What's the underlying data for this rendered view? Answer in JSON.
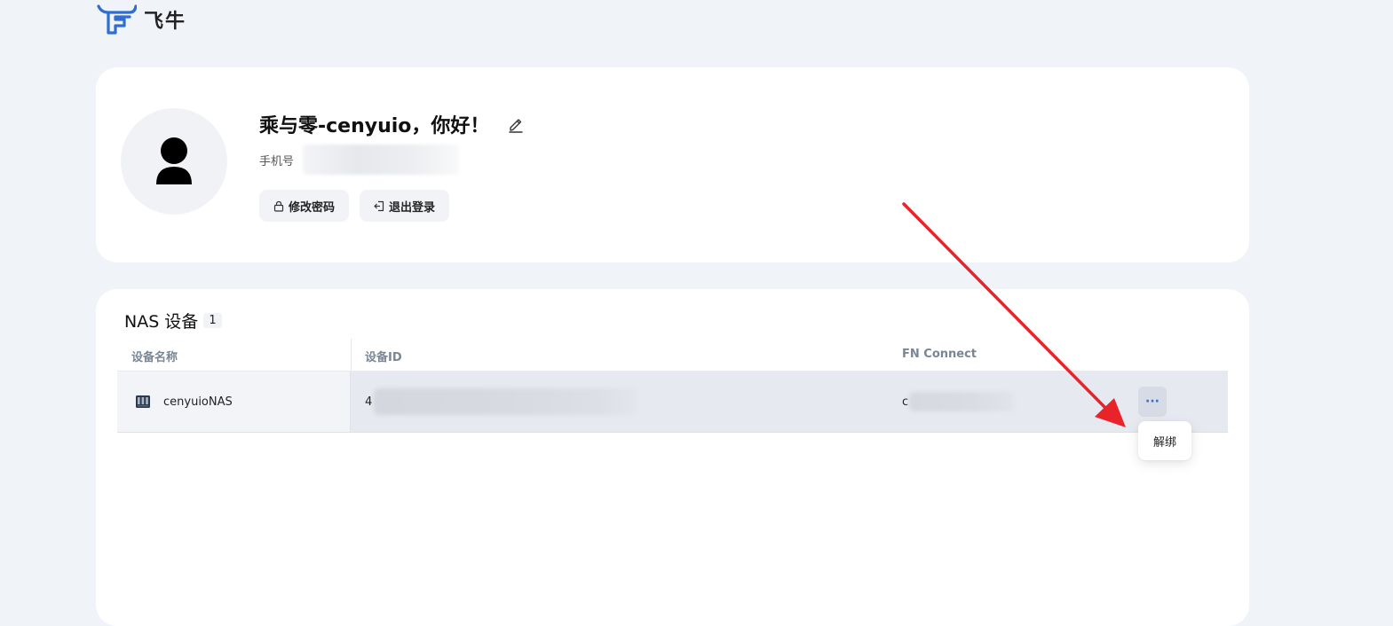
{
  "logo": {
    "text": "飞牛",
    "color": "#2f6ed1"
  },
  "profile": {
    "greeting": "乘与零-cenyuio，你好！",
    "phone_label": "手机号",
    "buttons": {
      "change_password": "修改密码",
      "logout": "退出登录"
    }
  },
  "devices": {
    "title": "NAS 设备",
    "count": "1",
    "columns": {
      "name": "设备名称",
      "id": "设备ID",
      "fn_connect": "FN Connect"
    },
    "rows": [
      {
        "name": "cenyuioNAS",
        "id_visible": "4",
        "fn_visible": "c",
        "icon": "nas-device-icon"
      }
    ],
    "more_label": "···",
    "menu": {
      "unbind": "解绑"
    }
  },
  "annotation": {
    "arrow_color": "#e8232a"
  }
}
